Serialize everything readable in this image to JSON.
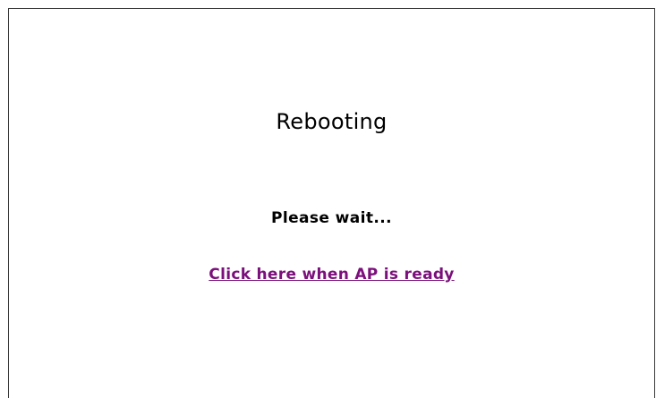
{
  "page": {
    "title": "Rebooting",
    "message": "Please wait...",
    "link_label": "Click here when AP is ready"
  },
  "colors": {
    "background": "#ffffff",
    "text": "#000000",
    "visited_link": "#7b0f7b",
    "frame_border": "#3a3a3a"
  }
}
